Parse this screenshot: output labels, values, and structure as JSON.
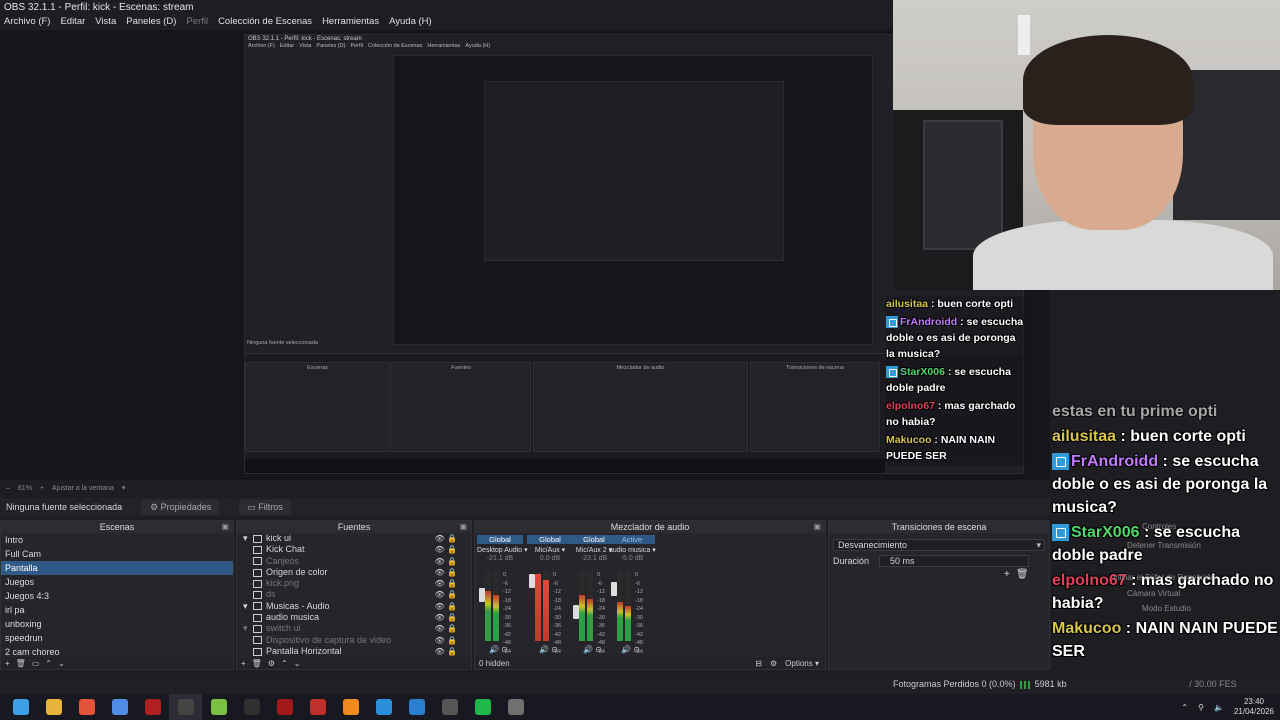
{
  "window": {
    "title": "OBS 32.1.1 - Perfil: kick - Escenas: stream"
  },
  "menu": [
    {
      "label": "Archivo (F)",
      "disabled": false
    },
    {
      "label": "Editar",
      "disabled": false
    },
    {
      "label": "Vista",
      "disabled": false
    },
    {
      "label": "Paneles (D)",
      "disabled": false
    },
    {
      "label": "Perfil",
      "disabled": true
    },
    {
      "label": "Colección de Escenas",
      "disabled": false
    },
    {
      "label": "Herramientas",
      "disabled": false
    },
    {
      "label": "Ayuda (H)",
      "disabled": false
    }
  ],
  "nested": {
    "title": "OBS 32.1.1 - Perfil: kick - Escenas: stream",
    "menu": [
      "Archivo (F)",
      "Editar",
      "Vista",
      "Paneles (D)",
      "Perfil",
      "Colección de Escenas",
      "Herramientas",
      "Ayuda (H)"
    ],
    "no_source": "Ninguna fuente seleccionada",
    "props": "Propiedades",
    "filters": "Filtros",
    "scenes_label": "Escenas",
    "sources_label": "Fuentes",
    "mixer_label": "Mezclador de audio",
    "trans_label": "Transiciones de escena"
  },
  "zoom": {
    "percent": "61%",
    "fit": "Ajustar a la ventana"
  },
  "propsbar": {
    "no_source": "Ninguna fuente seleccionada",
    "properties": "Propiedades",
    "filters": "Filtros"
  },
  "scenes": {
    "title": "Escenas",
    "items": [
      "Intro",
      "Full Cam",
      "Pantalla",
      "Juegos",
      "Juegos 4:3",
      "irl pa",
      "unboxing",
      "speedrun",
      "2 cam choreo"
    ],
    "active_index": 2
  },
  "sources": {
    "title": "Fuentes",
    "items": [
      {
        "label": "kick ui",
        "muted": false,
        "group": true
      },
      {
        "label": "Kick Chat",
        "muted": false,
        "group": false
      },
      {
        "label": "Canjeos",
        "muted": true,
        "group": false
      },
      {
        "label": "Origen de color",
        "muted": false,
        "group": false
      },
      {
        "label": "kick.png",
        "muted": true,
        "group": false
      },
      {
        "label": "ds",
        "muted": true,
        "group": false
      },
      {
        "label": "Musicas - Audio",
        "muted": false,
        "group": true
      },
      {
        "label": "audio musica",
        "muted": false,
        "group": false
      },
      {
        "label": "switch ui",
        "muted": true,
        "group": true
      },
      {
        "label": "Dispositivo de captura de video",
        "muted": true,
        "group": false
      },
      {
        "label": "Pantalla Horizontal",
        "muted": false,
        "group": false
      }
    ],
    "hidden": "0 hidden",
    "options": "Options"
  },
  "mixer": {
    "title": "Mezclador de audio",
    "channels": [
      {
        "scope": "Global",
        "name": "Desktop Audio",
        "db": "-21.1 dB",
        "level": 0.72,
        "fader": 0.7
      },
      {
        "scope": "Global",
        "name": "Mic/Aux",
        "db": "0.0 dB",
        "level": 0.95,
        "fader": 0.95
      },
      {
        "scope": "Global",
        "name": "Mic/Aux 2",
        "db": "-23.1 dB",
        "level": 0.65,
        "fader": 0.4
      },
      {
        "scope": "Active",
        "name": "audio musica",
        "db": "-5.0 dB",
        "level": 0.55,
        "fader": 0.8
      }
    ],
    "scale": [
      "0",
      "-6",
      "-12",
      "-18",
      "-24",
      "-30",
      "-36",
      "-42",
      "-48",
      "-54",
      "-60"
    ]
  },
  "transitions": {
    "title": "Transiciones de escena",
    "type": "Desvanecimiento",
    "duration_label": "Duración",
    "duration": "50 ms"
  },
  "chat_small": [
    {
      "user": "ailusitaa",
      "text": ": buen corte opti",
      "color": "#d7c64a",
      "kick": false
    },
    {
      "user": "FrAndroidd",
      "text": ": se escucha doble o es asi de poronga la musica?",
      "color": "#c27bff",
      "kick": true
    },
    {
      "user": "StarX006",
      "text": ": se escucha doble padre",
      "color": "#4fd96b",
      "kick": true
    },
    {
      "user": "elpolno67",
      "text": ": mas garchado no habia?",
      "color": "#e0415a",
      "kick": false
    },
    {
      "user": "Makucoo",
      "text": ": NAIN NAIN PUEDE SER",
      "color": "#d7c64a",
      "kick": false
    }
  ],
  "chat_large": [
    {
      "user": "",
      "text": "estas en tu prime opti",
      "color": "#ffffff",
      "kick": false,
      "faded": true
    },
    {
      "user": "ailusitaa",
      "text": ": buen corte opti",
      "color": "#d7c64a",
      "kick": false,
      "faded": false
    },
    {
      "user": "FrAndroidd",
      "text": ": se escucha doble o es asi de poronga la musica?",
      "color": "#c27bff",
      "kick": true,
      "faded": false
    },
    {
      "user": "StarX006",
      "text": ": se escucha doble padre",
      "color": "#4fd96b",
      "kick": true,
      "faded": false
    },
    {
      "user": "elpolno67",
      "text": ": mas garchado no habia?",
      "color": "#e0415a",
      "kick": false,
      "faded": false
    },
    {
      "user": "Makucoo",
      "text": ": NAIN NAIN PUEDE SER",
      "color": "#d7c64a",
      "kick": false,
      "faded": false
    }
  ],
  "controls_ghost": [
    "Controles",
    "Detener Transmisión",
    "Iniciar el Búfer de Repetición",
    "Cámara Virtual",
    "Modo Estudio"
  ],
  "status": {
    "frames": "Fotogramas Perdidos 0 (0.0%)",
    "rate": "5981 kb",
    "fps": "/ 30.00 FES"
  },
  "clock": {
    "time": "23:40",
    "date": "21/04/2026"
  },
  "taskbar_apps": [
    {
      "name": "windows-start-icon",
      "color": "#3ea0e6"
    },
    {
      "name": "file-explorer-icon",
      "color": "#e8b33a"
    },
    {
      "name": "brave-browser-icon",
      "color": "#e2533a"
    },
    {
      "name": "chrome-icon",
      "color": "#4f8de8"
    },
    {
      "name": "app-red-icon",
      "color": "#b02020"
    },
    {
      "name": "obs-icon",
      "color": "#444444"
    },
    {
      "name": "notepad-plus-icon",
      "color": "#7ac043"
    },
    {
      "name": "terminal-icon",
      "color": "#303030"
    },
    {
      "name": "app-red-2-icon",
      "color": "#a01818"
    },
    {
      "name": "app-red-3-icon",
      "color": "#c0302a"
    },
    {
      "name": "vlc-icon",
      "color": "#f08a1c"
    },
    {
      "name": "photos-icon",
      "color": "#2a8fd8"
    },
    {
      "name": "vscode-icon",
      "color": "#2a7fd0"
    },
    {
      "name": "calculator-icon",
      "color": "#555555"
    },
    {
      "name": "green-app-icon",
      "color": "#1fb84a"
    },
    {
      "name": "tool-icon",
      "color": "#707070"
    }
  ]
}
